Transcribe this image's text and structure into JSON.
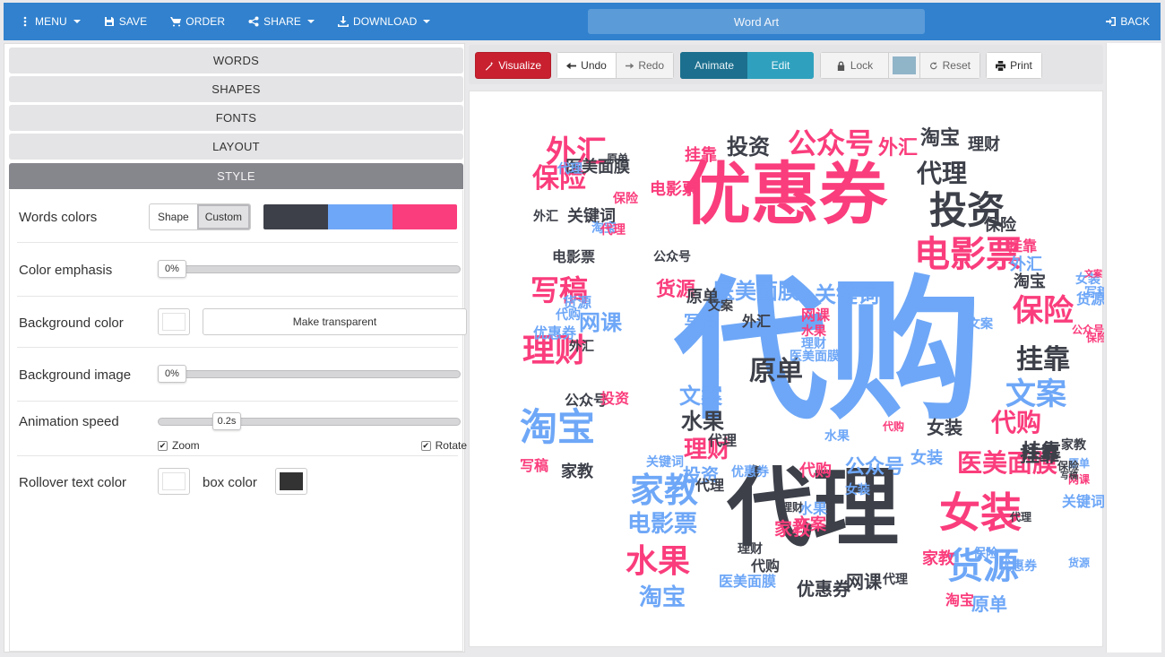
{
  "topbar": {
    "menu_label": "MENU",
    "save_label": "SAVE",
    "order_label": "ORDER",
    "share_label": "SHARE",
    "download_label": "DOWNLOAD",
    "title": "Word Art",
    "back_label": "BACK"
  },
  "accordion": {
    "words": "WORDS",
    "shapes": "SHAPES",
    "fonts": "FONTS",
    "layout": "LAYOUT",
    "style": "STYLE"
  },
  "style": {
    "words_colors": {
      "label": "Words colors",
      "options": [
        "Shape",
        "Custom"
      ],
      "selected": "Custom",
      "swatches": [
        "#3d4049",
        "#6ea7f7",
        "#fa3d7c"
      ]
    },
    "color_emphasis": {
      "label": "Color emphasis",
      "value": "0%",
      "fraction": 0
    },
    "background_color": {
      "label": "Background color",
      "value": "#ffffff",
      "transparent_button": "Make transparent"
    },
    "background_image": {
      "label": "Background image",
      "value": "0%",
      "fraction": 0
    },
    "animation_speed": {
      "label": "Animation speed",
      "value": "0.2s",
      "fraction": 0.18,
      "zoom_label": "Zoom",
      "zoom_checked": true,
      "rotate_label": "Rotate",
      "rotate_checked": true
    },
    "rollover": {
      "label": "Rollover text color",
      "text_color": "#ffffff",
      "box_label": "box color",
      "box_color": "#333333"
    }
  },
  "toolbar": {
    "visualize": "Visualize",
    "undo": "Undo",
    "redo": "Redo",
    "animate": "Animate",
    "edit": "Edit",
    "lock": "Lock",
    "lock_color": "#90b4c8",
    "reset": "Reset",
    "print": "Print"
  },
  "colors": {
    "dark": "#3d4049",
    "blue": "#6ea7f7",
    "pink": "#fa3d7c",
    "topbar": "#3181ce"
  },
  "cloud": {
    "words": [
      [
        "优惠券",
        "p",
        76,
        352,
        115
      ],
      [
        "代购",
        "b",
        172,
        400,
        290
      ],
      [
        "代理",
        "d",
        96,
        383,
        465
      ],
      [
        "投资",
        "d",
        42,
        555,
        133
      ],
      [
        "电影票",
        "p",
        40,
        556,
        182
      ],
      [
        "公众号",
        "p",
        32,
        403,
        58
      ],
      [
        "外汇",
        "p",
        34,
        119,
        68
      ],
      [
        "保险",
        "p",
        30,
        100,
        98
      ],
      [
        "写稿",
        "p",
        32,
        100,
        222
      ],
      [
        "理财",
        "p",
        36,
        95,
        290
      ],
      [
        "淘宝",
        "b",
        42,
        98,
        375
      ],
      [
        "家教",
        "b",
        38,
        217,
        445
      ],
      [
        "水果",
        "p",
        36,
        210,
        525
      ],
      [
        "电影票",
        "b",
        26,
        215,
        483
      ],
      [
        "淘宝",
        "b",
        26,
        215,
        565
      ],
      [
        "女装",
        "p",
        46,
        570,
        470
      ],
      [
        "货源",
        "b",
        40,
        573,
        530
      ],
      [
        "医美面膜",
        "p",
        28,
        600,
        415
      ],
      [
        "挂靠",
        "d",
        30,
        640,
        300
      ],
      [
        "保险",
        "p",
        34,
        640,
        245
      ],
      [
        "文案",
        "b",
        34,
        632,
        338
      ],
      [
        "代购",
        "p",
        28,
        610,
        370
      ],
      [
        "挂靠",
        "d",
        22,
        638,
        403
      ],
      [
        "原单",
        "d",
        30,
        342,
        313
      ],
      [
        "代理",
        "d",
        28,
        527,
        92
      ],
      [
        "投资",
        "d",
        24,
        311,
        62
      ],
      [
        "关键词",
        "b",
        24,
        421,
        227
      ],
      [
        "医美面膜",
        "b",
        24,
        320,
        223
      ],
      [
        "货源",
        "p",
        22,
        230,
        222
      ],
      [
        "网课",
        "b",
        24,
        146,
        258
      ],
      [
        "原单",
        "d",
        18,
        260,
        230
      ],
      [
        "关键词",
        "d",
        18,
        136,
        140
      ],
      [
        "电影票",
        "d",
        16,
        116,
        185
      ],
      [
        "挂靠",
        "p",
        18,
        258,
        72
      ],
      [
        "外汇",
        "p",
        22,
        478,
        64
      ],
      [
        "淘宝",
        "d",
        22,
        525,
        53
      ],
      [
        "理财",
        "d",
        18,
        574,
        60
      ],
      [
        "保险",
        "d",
        18,
        592,
        150
      ],
      [
        "挂靠",
        "p",
        16,
        617,
        173
      ],
      [
        "外汇",
        "b",
        18,
        621,
        194
      ],
      [
        "淘宝",
        "d",
        18,
        625,
        213
      ],
      [
        "优惠券",
        "b",
        16,
        95,
        270
      ],
      [
        "外汇",
        "d",
        14,
        125,
        285
      ],
      [
        "代购",
        "b",
        14,
        110,
        250
      ],
      [
        "货源",
        "b",
        16,
        120,
        236
      ],
      [
        "公众号",
        "d",
        16,
        130,
        345
      ],
      [
        "投资",
        "p",
        16,
        162,
        343
      ],
      [
        "家教",
        "d",
        18,
        120,
        425
      ],
      [
        "写稿",
        "p",
        16,
        72,
        418
      ],
      [
        "代理",
        "d",
        16,
        282,
        390
      ],
      [
        "文案",
        "b",
        24,
        258,
        340
      ],
      [
        "水果",
        "d",
        24,
        260,
        368
      ],
      [
        "理财",
        "p",
        26,
        265,
        400
      ],
      [
        "代理",
        "d",
        16,
        268,
        440
      ],
      [
        "优惠券",
        "b",
        14,
        313,
        425
      ],
      [
        "代购",
        "p",
        18,
        386,
        424
      ],
      [
        "公众号",
        "b",
        22,
        452,
        420
      ],
      [
        "投资",
        "b",
        20,
        258,
        428
      ],
      [
        "关键词",
        "b",
        14,
        218,
        414
      ],
      [
        "写稿",
        "b",
        18,
        257,
        258
      ],
      [
        "外汇",
        "d",
        16,
        320,
        257
      ],
      [
        "文案",
        "d",
        14,
        280,
        240
      ],
      [
        "网课",
        "p",
        16,
        386,
        250
      ],
      [
        "水果",
        "p",
        14,
        384,
        268
      ],
      [
        "理财",
        "b",
        14,
        384,
        282
      ],
      [
        "医美面膜",
        "b",
        14,
        385,
        296
      ],
      [
        "女装",
        "d",
        20,
        530,
        375
      ],
      [
        "女装",
        "b",
        18,
        510,
        410
      ],
      [
        "家教",
        "p",
        18,
        523,
        522
      ],
      [
        "优惠券",
        "d",
        20,
        395,
        555
      ],
      [
        "网课",
        "d",
        20,
        440,
        547
      ],
      [
        "原单",
        "b",
        20,
        580,
        572
      ],
      [
        "淘宝",
        "p",
        16,
        547,
        568
      ],
      [
        "医美面膜",
        "b",
        16,
        310,
        547
      ],
      [
        "代购",
        "d",
        16,
        330,
        530
      ],
      [
        "理财",
        "d",
        14,
        313,
        511
      ],
      [
        "文案",
        "p",
        18,
        380,
        484
      ],
      [
        "家教",
        "p",
        20,
        360,
        488
      ],
      [
        "水果",
        "b",
        16,
        383,
        466
      ],
      [
        "代购",
        "p",
        12,
        473,
        374
      ],
      [
        "女装",
        "b",
        14,
        433,
        445
      ],
      [
        "代理",
        "d",
        14,
        475,
        545
      ],
      [
        "水果",
        "b",
        14,
        410,
        385
      ],
      [
        "理财",
        "d",
        12,
        360,
        464
      ],
      [
        "代理",
        "b",
        14,
        112,
        87
      ],
      [
        "医美面膜",
        "d",
        18,
        143,
        85
      ],
      [
        "原单",
        "d",
        12,
        165,
        75
      ],
      [
        "电影票",
        "p",
        18,
        228,
        110
      ],
      [
        "外汇",
        "d",
        14,
        85,
        140
      ],
      [
        "保险",
        "p",
        14,
        174,
        120
      ],
      [
        "淘宝",
        "b",
        14,
        150,
        153
      ],
      [
        "代理",
        "p",
        14,
        160,
        155
      ],
      [
        "公众号",
        "d",
        14,
        226,
        185
      ],
      [
        "文案",
        "b",
        14,
        570,
        260
      ],
      [
        "女装",
        "b",
        14,
        690,
        210
      ],
      [
        "货源",
        "b",
        16,
        693,
        232
      ],
      [
        "写稿",
        "b",
        14,
        700,
        225
      ],
      [
        "文案",
        "p",
        10,
        696,
        205
      ],
      [
        "公众号",
        "p",
        12,
        690,
        266
      ],
      [
        "保险",
        "p",
        12,
        700,
        275
      ],
      [
        "家教",
        "d",
        14,
        674,
        395
      ],
      [
        "原单",
        "b",
        12,
        680,
        415
      ],
      [
        "网课",
        "p",
        12,
        680,
        433
      ],
      [
        "挂靠",
        "d",
        22,
        636,
        407
      ],
      [
        "保险",
        "d",
        12,
        668,
        418
      ],
      [
        "写稿",
        "d",
        10,
        669,
        430
      ],
      [
        "关键词",
        "b",
        16,
        685,
        458
      ],
      [
        "代理",
        "d",
        12,
        615,
        475
      ],
      [
        "优惠券",
        "b",
        14,
        612,
        530
      ],
      [
        "保险",
        "b",
        14,
        576,
        516
      ],
      [
        "货源",
        "b",
        12,
        680,
        526
      ]
    ]
  }
}
